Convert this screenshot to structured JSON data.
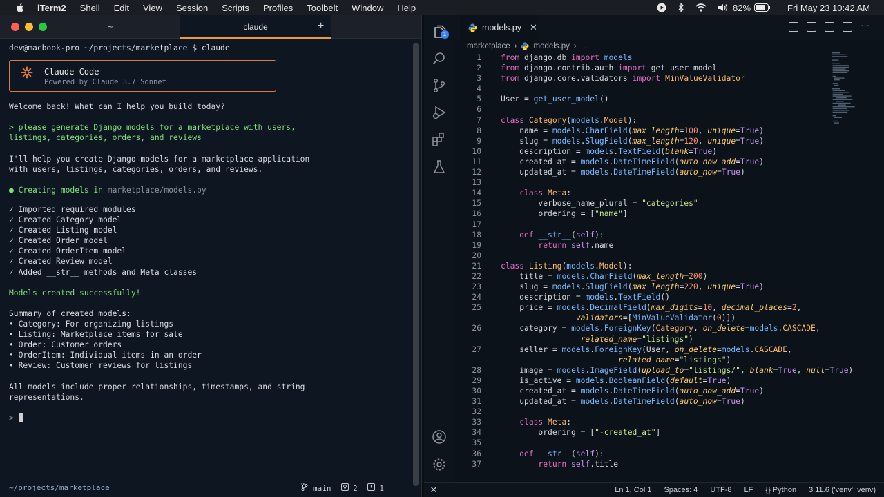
{
  "menubar": {
    "app_name": "iTerm2",
    "items": [
      "Shell",
      "Edit",
      "View",
      "Session",
      "Scripts",
      "Profiles",
      "Toolbelt",
      "Window",
      "Help"
    ],
    "battery": "82%",
    "datetime": "Fri May 23  10:42 AM"
  },
  "terminal": {
    "tabs": [
      "~",
      "claude"
    ],
    "prompt_line": "dev@macbook-pro ~/projects/marketplace $ claude",
    "banner_title": "Claude Code",
    "banner_subtitle": "Powered by Claude 3.7 Sonnet",
    "welcome": "Welcome back! What can I help you build today?",
    "user_prompt_1": "> please generate Django models for a marketplace with users,",
    "user_prompt_2": "listings, categories, orders, and reviews",
    "reply_1": "I'll help you create Django models for a marketplace application",
    "reply_2": "with users, listings, categories, orders, and reviews.",
    "creating_prefix": "● Creating models in ",
    "creating_path": "marketplace/models.py",
    "checks": [
      "✓ Imported required modules",
      "✓ Created Category model",
      "✓ Created Listing model",
      "✓ Created Order model",
      "✓ Created OrderItem model",
      "✓ Created Review model",
      "✓ Added __str__ methods and Meta classes"
    ],
    "success": "Models created successfully!",
    "summary_title": "Summary of created models:",
    "summary": [
      "• Category: For organizing listings",
      "• Listing: Marketplace items for sale",
      "• Order: Customer orders",
      "• OrderItem: Individual items in an order",
      "• Review: Customer reviews for listings"
    ],
    "closing_1": "All models include proper relationships, timestamps, and string",
    "closing_2": "representations.",
    "input_prompt": ">",
    "status_path": "~/projects/marketplace",
    "status_branch": "main",
    "status_warn": "2",
    "status_info": "1"
  },
  "vscode": {
    "tab_label": "models.py",
    "breadcrumb_folder": "marketplace",
    "breadcrumb_file": "models.py",
    "breadcrumb_more": "...",
    "activity_badge": "1",
    "status": {
      "position": "Ln 1, Col 1",
      "spaces": "Spaces: 4",
      "encoding": "UTF-8",
      "eol": "LF",
      "language": "Python",
      "interpreter": "3.11.6 ('venv': venv)"
    },
    "code": [
      {
        "n": "1",
        "t": "from django.db import models"
      },
      {
        "n": "2",
        "t": "from django.contrib.auth import get_user_model"
      },
      {
        "n": "3",
        "t": "from django.core.validators import MinValueValidator"
      },
      {
        "n": "4",
        "t": ""
      },
      {
        "n": "5",
        "t": "User = get_user_model()"
      },
      {
        "n": "6",
        "t": ""
      },
      {
        "n": "7",
        "t": "class Category(models.Model):"
      },
      {
        "n": "8",
        "t": "    name = models.CharField(max_length=100, unique=True)"
      },
      {
        "n": "9",
        "t": "    slug = models.SlugField(max_length=120, unique=True)"
      },
      {
        "n": "10",
        "t": "    description = models.TextField(blank=True)"
      },
      {
        "n": "11",
        "t": "    created_at = models.DateTimeField(auto_now_add=True)"
      },
      {
        "n": "12",
        "t": "    updated_at = models.DateTimeField(auto_now=True)"
      },
      {
        "n": "13",
        "t": ""
      },
      {
        "n": "14",
        "t": "    class Meta:"
      },
      {
        "n": "15",
        "t": "        verbose_name_plural = \"categories\""
      },
      {
        "n": "16",
        "t": "        ordering = [\"name\"]"
      },
      {
        "n": "17",
        "t": ""
      },
      {
        "n": "18",
        "t": "    def __str__(self):"
      },
      {
        "n": "19",
        "t": "        return self.name"
      },
      {
        "n": "20",
        "t": ""
      },
      {
        "n": "21",
        "t": "class Listing(models.Model):"
      },
      {
        "n": "22",
        "t": "    title = models.CharField(max_length=200)"
      },
      {
        "n": "23",
        "t": "    slug = models.SlugField(max_length=220, unique=True)"
      },
      {
        "n": "24",
        "t": "    description = models.TextField()"
      },
      {
        "n": "25",
        "t": "    price = models.DecimalField(max_digits=10, decimal_places=2,"
      },
      {
        "n": "",
        "t": "                validators=[MinValueValidator(0)])"
      },
      {
        "n": "26",
        "t": "    category = models.ForeignKey(Category, on_delete=models.CASCADE,"
      },
      {
        "n": "",
        "t": "                 related_name=\"listings\")"
      },
      {
        "n": "27",
        "t": "    seller = models.ForeignKey(User, on_delete=models.CASCADE,"
      },
      {
        "n": "",
        "t": "                         related_name=\"listings\")"
      },
      {
        "n": "28",
        "t": "    image = models.ImageField(upload_to=\"listings/\", blank=True, null=True)"
      },
      {
        "n": "29",
        "t": "    is_active = models.BooleanField(default=True)"
      },
      {
        "n": "30",
        "t": "    created_at = models.DateTimeField(auto_now_add=True)"
      },
      {
        "n": "31",
        "t": "    updated_at = models.DateTimeField(auto_now=True)"
      },
      {
        "n": "32",
        "t": ""
      },
      {
        "n": "33",
        "t": "    class Meta:"
      },
      {
        "n": "34",
        "t": "        ordering = [\"-created_at\"]"
      },
      {
        "n": "35",
        "t": ""
      },
      {
        "n": "36",
        "t": "    def __str__(self):"
      },
      {
        "n": "37",
        "t": "        return self.title"
      }
    ]
  }
}
